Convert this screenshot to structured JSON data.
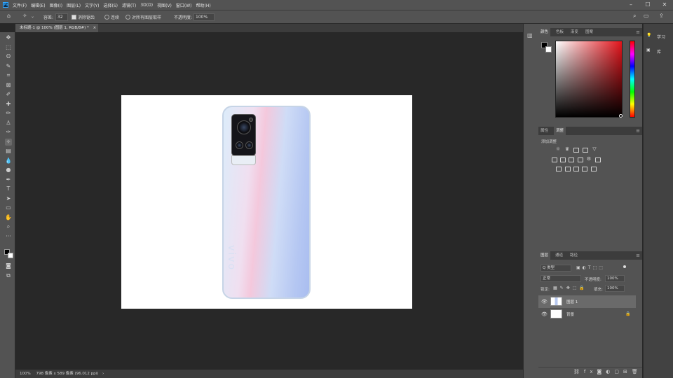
{
  "app": {
    "logo": "Ps"
  },
  "menu": [
    "文件(F)",
    "编辑(E)",
    "图像(I)",
    "图层(L)",
    "文字(Y)",
    "选择(S)",
    "滤镜(T)",
    "3D(D)",
    "视图(V)",
    "窗口(W)",
    "帮助(H)"
  ],
  "options": {
    "tolerance_label": "容差:",
    "tolerance_value": "32",
    "antialias_label": "消除锯齿",
    "contiguous_label": "连续",
    "sample_all_label": "对所有图层取样",
    "opacity_label": "不透明度:",
    "opacity_value": "100%"
  },
  "document_tab": {
    "title": "未标题-1 @ 100% (图层 1, RGB/8#) *",
    "close": "×"
  },
  "status": {
    "zoom": "100%",
    "info": "798 像素 x 589 像素 (96.012 ppi)"
  },
  "canvas": {
    "phone_brand": "vivo"
  },
  "color_panel": {
    "tabs": [
      "颜色",
      "色板",
      "渐变",
      "图案"
    ]
  },
  "adjust_panel": {
    "tabs": [
      "属性",
      "调整"
    ],
    "add_label": "添加调整"
  },
  "layers_panel": {
    "tabs": [
      "图层",
      "通道",
      "路径"
    ],
    "filter": "Q 类型",
    "blend_mode": "正常",
    "opacity_label": "不透明度:",
    "opacity_value": "100%",
    "lock_label": "锁定:",
    "fill_label": "填充:",
    "fill_value": "100%",
    "layers": [
      {
        "name": "图层 1",
        "selected": true
      },
      {
        "name": "背景",
        "selected": false
      }
    ]
  },
  "learn_panel": {
    "learn_label": "学习",
    "library_label": "库"
  },
  "colors": {
    "accent": "#31a8ff",
    "panel": "#535353",
    "canvas_bg": "#282828",
    "picked": "#e3141b"
  }
}
